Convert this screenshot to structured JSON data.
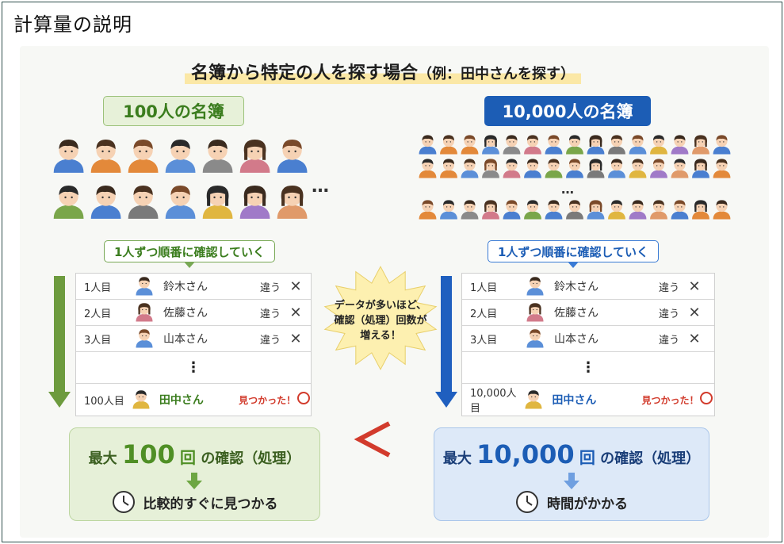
{
  "page": {
    "title": "計算量の説明"
  },
  "diagram": {
    "title": "名簿から特定の人を探す場合",
    "title_sub": "（例：田中さんを探す）",
    "left": {
      "label": "100人の名簿",
      "step": "1人ずつ順番に確認していく",
      "rows": [
        {
          "num": "1人目",
          "name": "鈴木さん",
          "result": "違う",
          "mark": "✕"
        },
        {
          "num": "2人目",
          "name": "佐藤さん",
          "result": "違う",
          "mark": "✕"
        },
        {
          "num": "3人目",
          "name": "山本さん",
          "result": "違う",
          "mark": "✕"
        }
      ],
      "dots": "⋮",
      "found": {
        "num": "100人目",
        "name": "田中さん",
        "result": "見つかった！"
      },
      "summary": {
        "prefix": "最大",
        "count": "100",
        "unit": "回",
        "suffix": "の確認（処理）",
        "foot": "比較的すぐに見つかる"
      }
    },
    "right": {
      "label": "10,000人の名簿",
      "step": "1人ずつ順番に確認していく",
      "rows": [
        {
          "num": "1人目",
          "name": "鈴木さん",
          "result": "違う",
          "mark": "✕"
        },
        {
          "num": "2人目",
          "name": "佐藤さん",
          "result": "違う",
          "mark": "✕"
        },
        {
          "num": "3人目",
          "name": "山本さん",
          "result": "違う",
          "mark": "✕"
        }
      ],
      "dots": "⋮",
      "found": {
        "num": "10,000人目",
        "name": "田中さん",
        "result": "見つかった！"
      },
      "summary": {
        "prefix": "最大",
        "count": "10,000",
        "unit": "回",
        "suffix": "の確認（処理）",
        "foot": "時間がかかる"
      }
    },
    "burst": {
      "line1": "データが多いほど、",
      "line2": "確認（処理）回数が",
      "line3": "増える！"
    },
    "ellipsis": "…",
    "comparison": "<",
    "colors": {
      "green": "#4f8f25",
      "blue": "#1c5db5",
      "red": "#d23b2c",
      "highlight": "#fbe8a6",
      "burst": "#fdf0b0"
    }
  }
}
